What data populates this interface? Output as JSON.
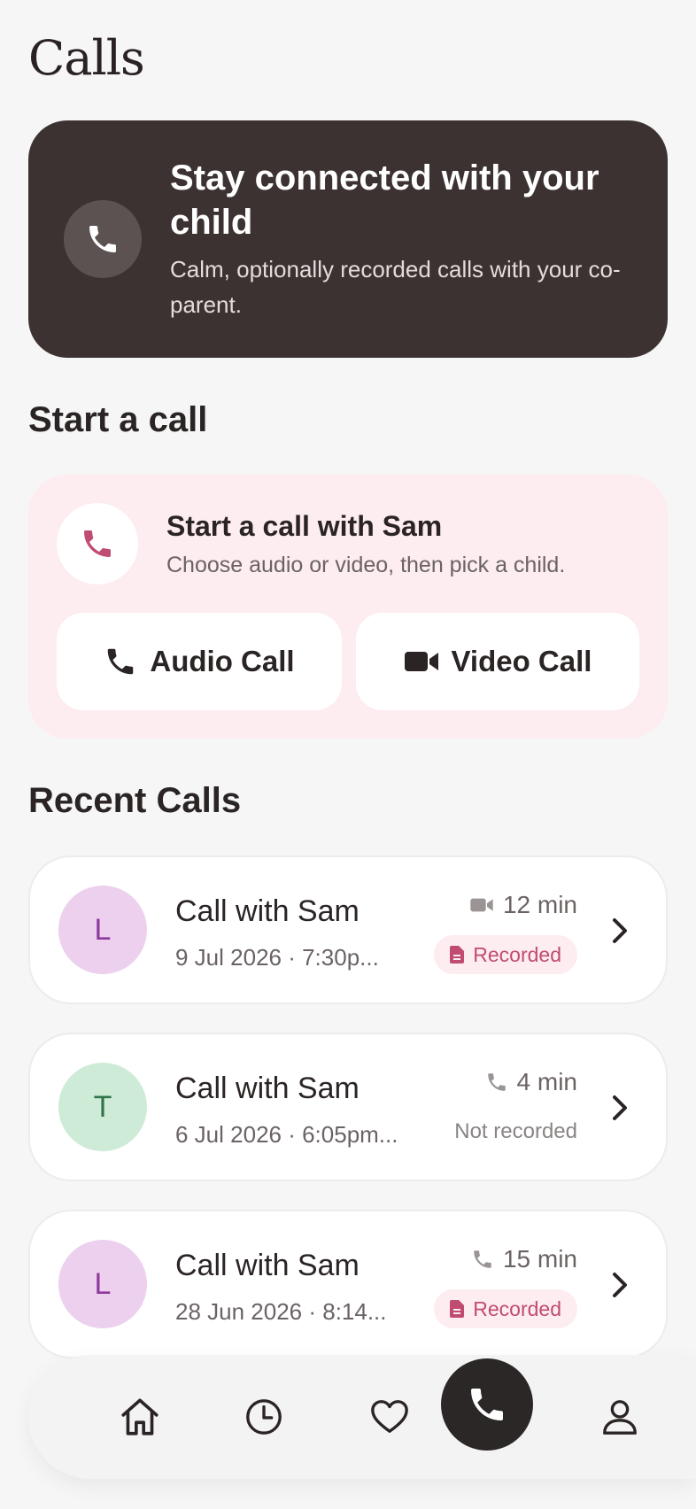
{
  "page": {
    "title": "Calls"
  },
  "hero": {
    "title": "Stay connected with your child",
    "subtitle": "Calm, optionally recorded calls with your co-parent."
  },
  "start_section": {
    "heading": "Start a call",
    "card_title": "Start a call with Sam",
    "card_subtitle": "Choose audio or video, then pick a child.",
    "audio_label": "Audio Call",
    "video_label": "Video Call"
  },
  "recent": {
    "heading": "Recent Calls",
    "items": [
      {
        "initial": "L",
        "title": "Call with Sam",
        "subtitle": "9 Jul 2026 · 7:30p...",
        "duration": "12 min",
        "type": "video",
        "status": "Recorded",
        "avatar_bg": "#ecd0ee",
        "avatar_fg": "#8e3a9c"
      },
      {
        "initial": "T",
        "title": "Call with Sam",
        "subtitle": "6 Jul 2026 · 6:05pm...",
        "duration": "4 min",
        "type": "audio",
        "status": "Not recorded",
        "avatar_bg": "#cdebd6",
        "avatar_fg": "#2f7448"
      },
      {
        "initial": "L",
        "title": "Call with Sam",
        "subtitle": "28 Jun 2026 · 8:14...",
        "duration": "15 min",
        "type": "audio",
        "status": "Recorded",
        "avatar_bg": "#ecd0ee",
        "avatar_fg": "#8e3a9c"
      }
    ]
  },
  "nav": {
    "items": [
      "home-icon",
      "clock-icon",
      "heart-icon",
      "phone-icon",
      "person-icon"
    ],
    "active": "phone-icon"
  },
  "colors": {
    "hero_bg": "#3d3232",
    "accent_pink": "#c04c72",
    "start_card_bg": "#fdecf0"
  }
}
